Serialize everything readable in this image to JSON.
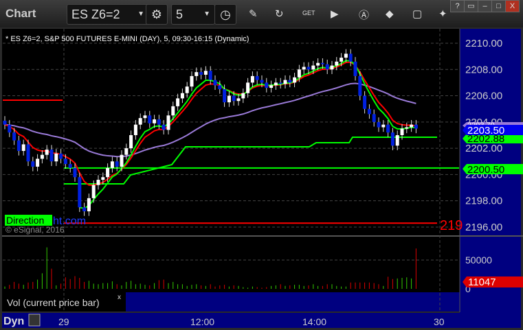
{
  "app": {
    "title": "Chart",
    "symbol": "ES Z6=2",
    "interval": "5",
    "window_buttons": [
      "?",
      "▭",
      "–",
      "□",
      "X"
    ]
  },
  "toolbar": {
    "icons": [
      "settings-icon",
      "clock-icon",
      "pencil-icon",
      "refresh-icon",
      "get-icon",
      "play-icon",
      "a-icon",
      "link-icon",
      "comment-icon",
      "twitter-icon"
    ]
  },
  "chart": {
    "header": "* ES Z6=2, S&P 500 FUTURES E-MINI (DAY), 5, 09:30-16:15 (Dynamic)",
    "copyright": "© eSignal, 2016",
    "watermark_green": "Direction",
    "watermark_blue": "ht.com",
    "red_level_label": "219",
    "price_ticks": [
      "2210.00",
      "2208.00",
      "2206.00",
      "2204.00",
      "2202.00",
      "2200.00",
      "2198.00",
      "2196.00"
    ],
    "price_tick_values": [
      2210,
      2208,
      2206,
      2204,
      2202,
      2200,
      2198,
      2196
    ],
    "last_price_label": "2203.50",
    "purple_label": "2203.70",
    "green_label_1": "2202.88",
    "green_label_2": "2200.50",
    "levels": {
      "green_1": 2200.5,
      "green_2": 2202.88,
      "red": 2196.3
    },
    "colors": {
      "up": "#ffffff",
      "down": "#0020e0",
      "vol_up": "#33cc00",
      "vol_down": "#dd0000",
      "axis_bg": "#000080",
      "green": "#00ff00",
      "red": "#ff0000",
      "purple": "#9a7ad8"
    },
    "closes": [
      2203.8,
      2203.2,
      2202.6,
      2201.8,
      2202.3,
      2201.0,
      2200.6,
      2201.2,
      2201.5,
      2201.9,
      2201.0,
      2201.6,
      2201.2,
      2200.8,
      2200.5,
      2199.8,
      2197.5,
      2197.2,
      2198.2,
      2199.2,
      2199.6,
      2199.8,
      2200.5,
      2201.0,
      2200.6,
      2201.5,
      2202.0,
      2203.0,
      2203.8,
      2204.3,
      2204.5,
      2203.9,
      2204.2,
      2203.8,
      2203.4,
      2204.5,
      2205.2,
      2205.8,
      2206.2,
      2206.7,
      2207.5,
      2207.8,
      2207.6,
      2207.9,
      2207.2,
      2206.8,
      2206.5,
      2205.5,
      2206.0,
      2205.6,
      2205.8,
      2206.2,
      2207.0,
      2207.5,
      2207.2,
      2207.0,
      2206.6,
      2206.8,
      2207.0,
      2206.9,
      2207.2,
      2207.0,
      2207.4,
      2208.0,
      2208.2,
      2208.0,
      2208.3,
      2208.5,
      2208.4,
      2208.0,
      2208.3,
      2208.6,
      2208.9,
      2209.2,
      2208.6,
      2207.5,
      2206.0,
      2205.0,
      2204.6,
      2204.0,
      2203.6,
      2203.8,
      2203.2,
      2202.2,
      2203.0,
      2203.5,
      2203.6,
      2203.8,
      2203.5
    ],
    "volume": [
      4000,
      7000,
      12000,
      9000,
      7000,
      11000,
      12000,
      16000,
      27000,
      72000,
      35000,
      6000,
      9000,
      20000,
      17000,
      22000,
      19000,
      12000,
      14000,
      9000,
      8000,
      10000,
      10000,
      13000,
      8000,
      6000,
      12000,
      14000,
      8000,
      9000,
      7000,
      6000,
      10000,
      15000,
      16000,
      10000,
      12000,
      8000,
      8000,
      5000,
      7000,
      8000,
      6000,
      5000,
      8000,
      4000,
      6000,
      7000,
      4000,
      6000,
      5000,
      3000,
      2000,
      4000,
      3000,
      2000,
      3000,
      5000,
      6000,
      8000,
      5000,
      6000,
      7000,
      7000,
      5000,
      6000,
      8000,
      5000,
      5000,
      8000,
      8000,
      5000,
      4000,
      4000,
      11000,
      11000,
      11000,
      11000,
      11000,
      10000,
      8000,
      5000,
      21000,
      17000,
      18000,
      19000,
      20000,
      18000,
      70000,
      14000,
      4000,
      11047
    ],
    "volume_ticks": [
      "50000",
      "0"
    ],
    "volume_label": "11047",
    "volume_study": "Vol (current price bar)",
    "close_x": "x",
    "time_ticks": [
      "29",
      "12:00",
      "14:00",
      "30"
    ],
    "dyn": "Dyn"
  }
}
